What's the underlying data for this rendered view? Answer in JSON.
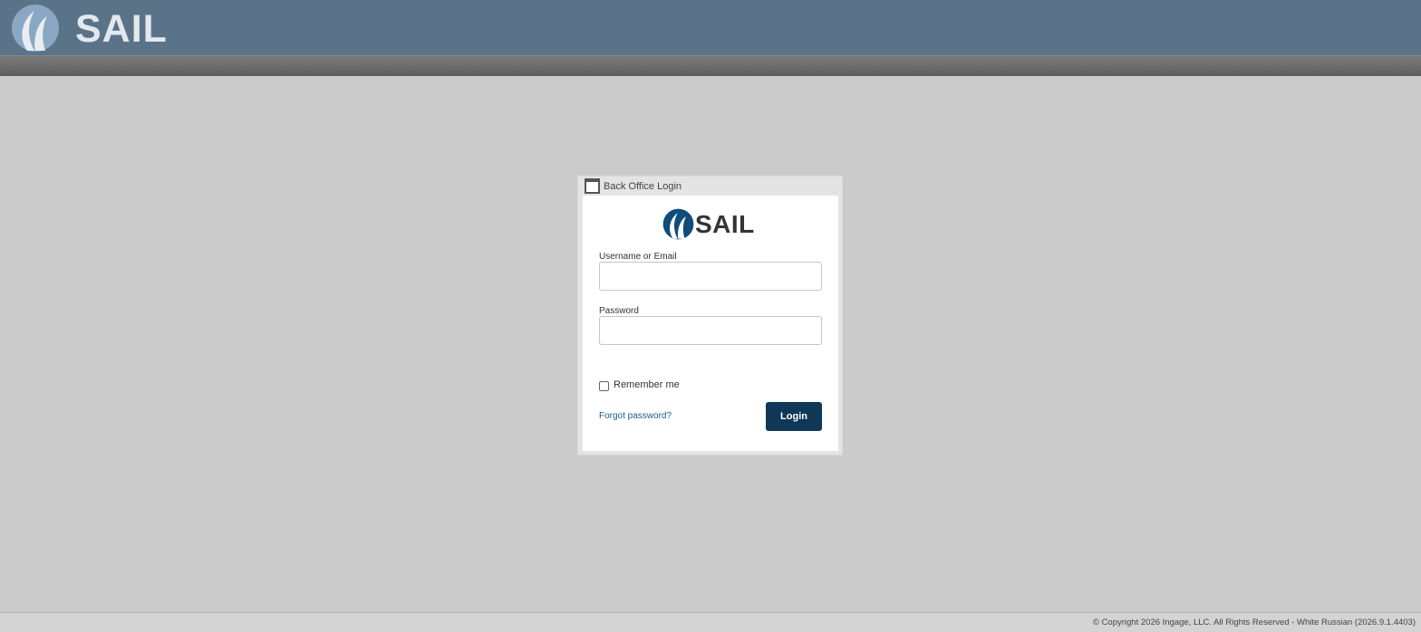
{
  "header": {
    "logo_text": "SAIL"
  },
  "login_window": {
    "title": "Back Office Login",
    "logo_text": "SAIL",
    "username_label": "Username or Email",
    "username_value": "",
    "password_label": "Password",
    "password_value": "",
    "remember_label": "Remember me",
    "remember_checked": false,
    "forgot_label": "Forgot password?",
    "login_label": "Login"
  },
  "footer": {
    "copyright": "© Copyright 2026 Ingage, LLC. All Rights Reserved - White Russian (2026.9.1.4403)"
  },
  "colors": {
    "header_bg": "#5b7389",
    "page_bg": "#cbcbcb",
    "brand_blue": "#0e3758",
    "link": "#1c5d8a"
  },
  "icons": {
    "header_logo": "sail-logo-icon",
    "form_logo": "sail-logo-icon",
    "window": "window-icon"
  }
}
